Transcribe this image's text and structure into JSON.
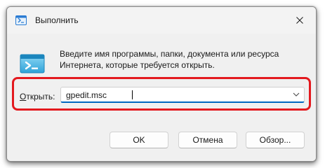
{
  "window": {
    "title": "Выполнить",
    "icons": {
      "app": "run-app-icon",
      "close": "close-icon",
      "run": "run-program-icon"
    }
  },
  "dialog": {
    "description": "Введите имя программы, папки, документа или ресурса Интернета, которые требуется открыть.",
    "open_label_accel": "О",
    "open_label_rest": "ткрыть:",
    "input_value": "gpedit.msc",
    "highlight_color": "#e3191e",
    "accent_color": "#0067c0"
  },
  "buttons": {
    "ok": "OK",
    "cancel": "Отмена",
    "browse": "Обзор..."
  }
}
